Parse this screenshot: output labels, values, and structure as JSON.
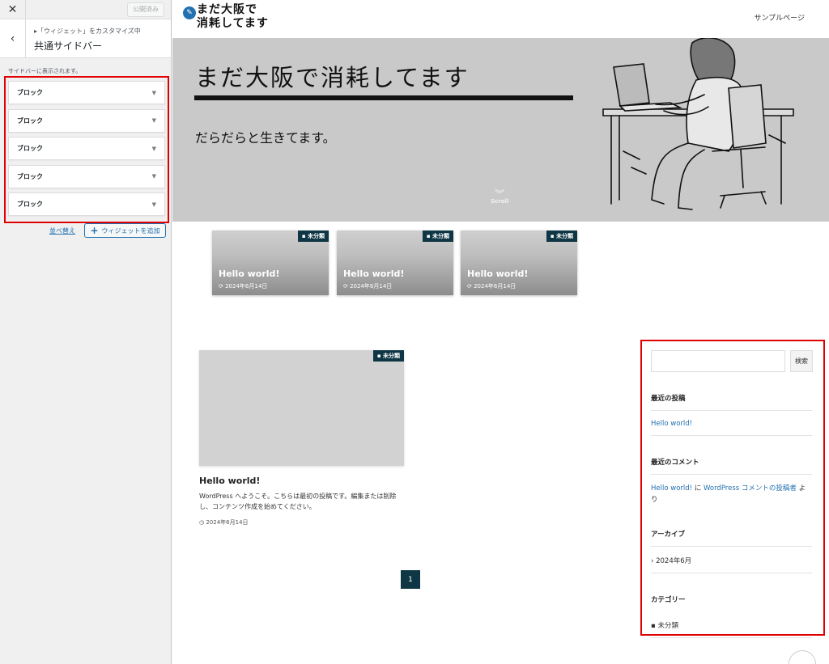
{
  "customizer": {
    "close_label": "✕",
    "publish_label": "公開済み",
    "back_label": "‹",
    "breadcrumb": "「ウィジェット」をカスタマイズ中",
    "title": "共通サイドバー",
    "description": "サイドバーに表示されます。",
    "widgets": [
      {
        "label": "ブロック"
      },
      {
        "label": "ブロック"
      },
      {
        "label": "ブロック"
      },
      {
        "label": "ブロック"
      },
      {
        "label": "ブロック"
      }
    ],
    "reorder_label": "並べ替え",
    "add_widget_label": "ウィジェットを追加"
  },
  "site": {
    "logo_line1": "まだ大阪で",
    "logo_line2": "消耗してます",
    "nav_item": "サンプルページ"
  },
  "hero": {
    "title": "まだ大阪で消耗してます",
    "subtitle": "だらだらと生きてます。",
    "scroll_label": "Scroll"
  },
  "cards": [
    {
      "category": "未分類",
      "title": "Hello world!",
      "date": "2024年6月14日"
    },
    {
      "category": "未分類",
      "title": "Hello world!",
      "date": "2024年6月14日"
    },
    {
      "category": "未分類",
      "title": "Hello world!",
      "date": "2024年6月14日"
    }
  ],
  "post": {
    "category": "未分類",
    "title": "Hello world!",
    "excerpt": "WordPress へようこそ。こちらは最初の投稿です。編集または削除し、コンテンツ作成を始めてください。",
    "date": "2024年6月14日"
  },
  "pagination": {
    "current": "1"
  },
  "sidebar": {
    "search_button": "検索",
    "recent_posts_heading": "最近の投稿",
    "recent_post": "Hello world!",
    "recent_comments_heading": "最近のコメント",
    "comment_post": "Hello world!",
    "comment_connector": "に",
    "comment_author": "WordPress コメントの投稿者",
    "comment_suffix": "より",
    "archives_heading": "アーカイブ",
    "archive_item": "2024年6月",
    "categories_heading": "カテゴリー",
    "category_item": "未分類"
  },
  "colors": {
    "accent": "#0f3645",
    "link": "#2271b1",
    "highlight": "#e00000"
  }
}
